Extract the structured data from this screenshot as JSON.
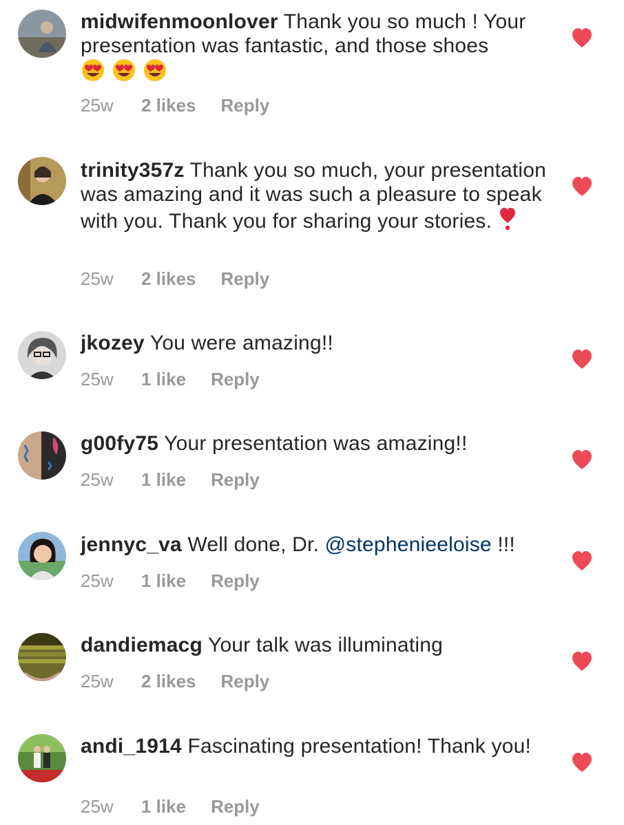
{
  "colors": {
    "heart": "#ed4956",
    "mention": "#003569",
    "meta": "#999999",
    "text": "#262626"
  },
  "comments": [
    {
      "username": "midwifenmoonlover",
      "text": " Thank you so much ! Your presentation was fantastic, and those shoes",
      "emoji": "heart-eyes-face x3",
      "time": "25w",
      "likes": "2 likes",
      "reply": "Reply"
    },
    {
      "username": "trinity357z",
      "text": " Thank you so much, your presentation was amazing and it was such a pleasure to speak with you. Thank you for sharing your stories. ",
      "emoji": "heavy-heart-exclamation",
      "time": "25w",
      "likes": "2 likes",
      "reply": "Reply"
    },
    {
      "username": "jkozey",
      "text": " You were amazing!!",
      "time": "25w",
      "likes": "1 like",
      "reply": "Reply"
    },
    {
      "username": "g00fy75",
      "text": " Your presentation was amazing!!",
      "time": "25w",
      "likes": "1 like",
      "reply": "Reply"
    },
    {
      "username": "jennyc_va",
      "text": " Well done, Dr. ",
      "mention": "@stephenieeloise",
      "text_after": " !!!",
      "time": "25w",
      "likes": "1 like",
      "reply": "Reply"
    },
    {
      "username": "dandiemacg",
      "text": " Your talk was illuminating",
      "time": "25w",
      "likes": "2 likes",
      "reply": "Reply"
    },
    {
      "username": "andi_1914",
      "text": " Fascinating presentation! Thank you!",
      "time": "25w",
      "likes": "1 like",
      "reply": "Reply"
    }
  ]
}
